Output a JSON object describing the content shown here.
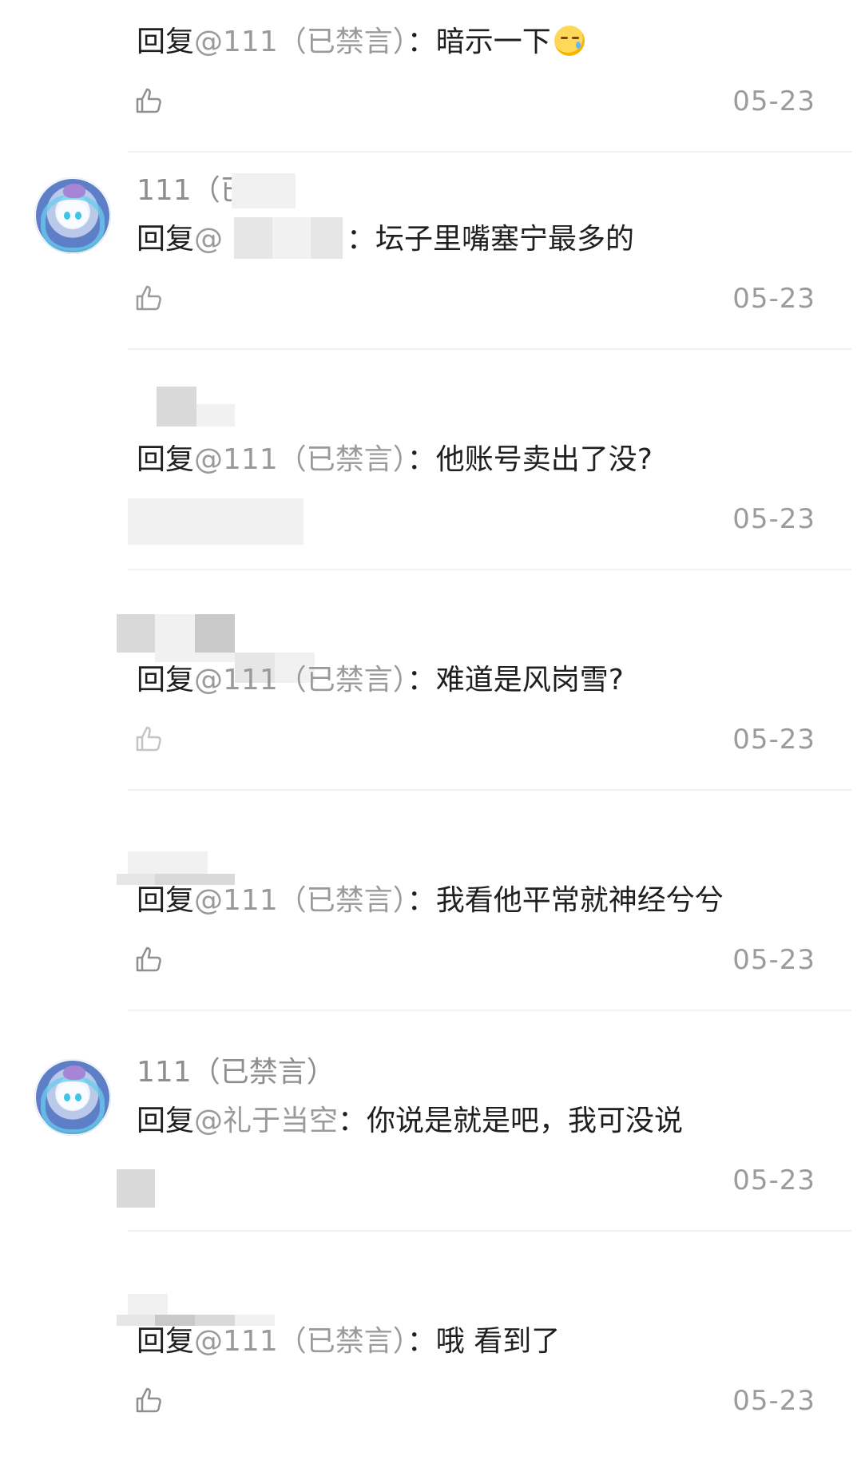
{
  "thread": {
    "comments": [
      {
        "user_name": "",
        "reply_prefix": "回复",
        "mention": "@111（已禁言）",
        "colon": "：",
        "text": "暗示一下",
        "emoji": "sleepy-face",
        "date": "05-23"
      },
      {
        "user_name": "111（已禁",
        "reply_prefix": "回复",
        "mention": "@",
        "colon": "：",
        "text": "坛子里嘴塞宁最多的",
        "date": "05-23"
      },
      {
        "user_name": "",
        "reply_prefix": "回复",
        "mention": "@111（已禁言）",
        "colon": "：",
        "text": "他账号卖出了没?",
        "date": "05-23"
      },
      {
        "user_name": "",
        "reply_prefix": "回复",
        "mention": "@111（已禁言）",
        "colon": "：",
        "text": "难道是风岗雪?",
        "date": "05-23"
      },
      {
        "user_name": "",
        "reply_prefix": "回复",
        "mention": "@111（已禁言）",
        "colon": "：",
        "text": "我看他平常就神经兮兮",
        "date": "05-23"
      },
      {
        "user_name": "111（已禁言）",
        "reply_prefix": "回复",
        "mention": "@礼于当空",
        "colon": "：",
        "text": "你说是就是吧，我可没说",
        "date": "05-23"
      },
      {
        "user_name": "",
        "reply_prefix": "回复",
        "mention": "@111（已禁言）",
        "colon": "：",
        "text": "哦 看到了",
        "date": "05-23"
      }
    ]
  },
  "colors": {
    "text_main": "#1f1f1f",
    "text_muted": "#9a9a9a",
    "divider": "#f1f1f1"
  }
}
